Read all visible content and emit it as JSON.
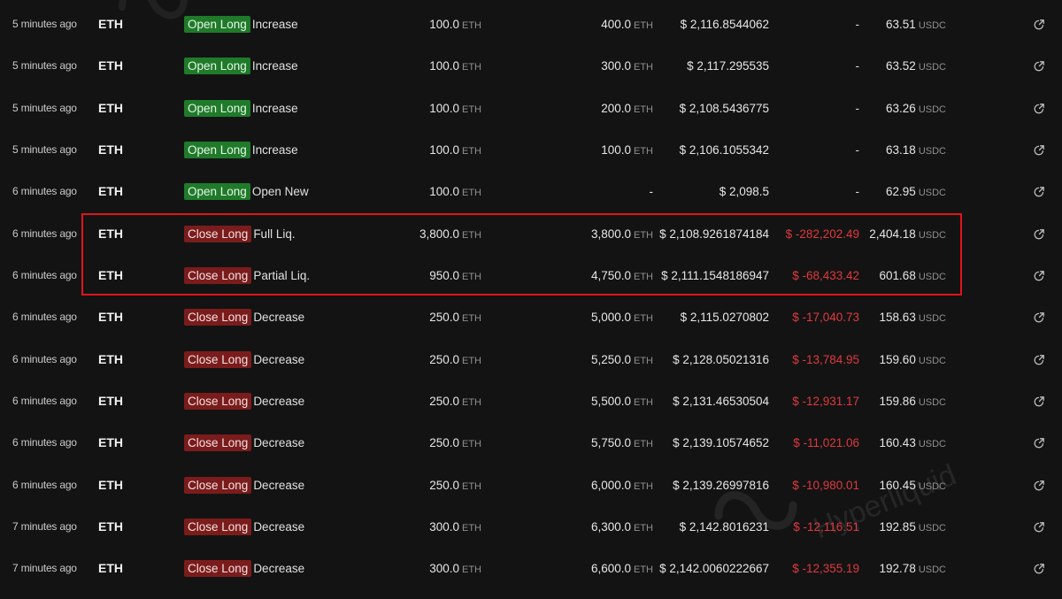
{
  "rows": [
    {
      "time": "5 minutes ago",
      "coin": "ETH",
      "direction": "Open Long",
      "kind": "open",
      "action": "Increase",
      "size": "100.0",
      "size_unit": "ETH",
      "position": "400.0",
      "position_unit": "ETH",
      "price": "$ 2,116.8544062",
      "pnl": "-",
      "pnl_neg": false,
      "fee": "63.51",
      "fee_unit": "USDC"
    },
    {
      "time": "5 minutes ago",
      "coin": "ETH",
      "direction": "Open Long",
      "kind": "open",
      "action": "Increase",
      "size": "100.0",
      "size_unit": "ETH",
      "position": "300.0",
      "position_unit": "ETH",
      "price": "$ 2,117.295535",
      "pnl": "-",
      "pnl_neg": false,
      "fee": "63.52",
      "fee_unit": "USDC"
    },
    {
      "time": "5 minutes ago",
      "coin": "ETH",
      "direction": "Open Long",
      "kind": "open",
      "action": "Increase",
      "size": "100.0",
      "size_unit": "ETH",
      "position": "200.0",
      "position_unit": "ETH",
      "price": "$ 2,108.5436775",
      "pnl": "-",
      "pnl_neg": false,
      "fee": "63.26",
      "fee_unit": "USDC"
    },
    {
      "time": "5 minutes ago",
      "coin": "ETH",
      "direction": "Open Long",
      "kind": "open",
      "action": "Increase",
      "size": "100.0",
      "size_unit": "ETH",
      "position": "100.0",
      "position_unit": "ETH",
      "price": "$ 2,106.1055342",
      "pnl": "-",
      "pnl_neg": false,
      "fee": "63.18",
      "fee_unit": "USDC"
    },
    {
      "time": "6 minutes ago",
      "coin": "ETH",
      "direction": "Open Long",
      "kind": "open",
      "action": "Open New",
      "size": "100.0",
      "size_unit": "ETH",
      "position": "-",
      "position_unit": "",
      "price": "$ 2,098.5",
      "pnl": "-",
      "pnl_neg": false,
      "fee": "62.95",
      "fee_unit": "USDC"
    },
    {
      "time": "6 minutes ago",
      "coin": "ETH",
      "direction": "Close Long",
      "kind": "close",
      "action": "Full Liq.",
      "size": "3,800.0",
      "size_unit": "ETH",
      "position": "3,800.0",
      "position_unit": "ETH",
      "price": "$ 2,108.9261874184",
      "pnl": "$ -282,202.49",
      "pnl_neg": true,
      "fee": "2,404.18",
      "fee_unit": "USDC"
    },
    {
      "time": "6 minutes ago",
      "coin": "ETH",
      "direction": "Close Long",
      "kind": "close",
      "action": "Partial Liq.",
      "size": "950.0",
      "size_unit": "ETH",
      "position": "4,750.0",
      "position_unit": "ETH",
      "price": "$ 2,111.1548186947",
      "pnl": "$ -68,433.42",
      "pnl_neg": true,
      "fee": "601.68",
      "fee_unit": "USDC"
    },
    {
      "time": "6 minutes ago",
      "coin": "ETH",
      "direction": "Close Long",
      "kind": "close",
      "action": "Decrease",
      "size": "250.0",
      "size_unit": "ETH",
      "position": "5,000.0",
      "position_unit": "ETH",
      "price": "$ 2,115.0270802",
      "pnl": "$ -17,040.73",
      "pnl_neg": true,
      "fee": "158.63",
      "fee_unit": "USDC"
    },
    {
      "time": "6 minutes ago",
      "coin": "ETH",
      "direction": "Close Long",
      "kind": "close",
      "action": "Decrease",
      "size": "250.0",
      "size_unit": "ETH",
      "position": "5,250.0",
      "position_unit": "ETH",
      "price": "$ 2,128.05021316",
      "pnl": "$ -13,784.95",
      "pnl_neg": true,
      "fee": "159.60",
      "fee_unit": "USDC"
    },
    {
      "time": "6 minutes ago",
      "coin": "ETH",
      "direction": "Close Long",
      "kind": "close",
      "action": "Decrease",
      "size": "250.0",
      "size_unit": "ETH",
      "position": "5,500.0",
      "position_unit": "ETH",
      "price": "$ 2,131.46530504",
      "pnl": "$ -12,931.17",
      "pnl_neg": true,
      "fee": "159.86",
      "fee_unit": "USDC"
    },
    {
      "time": "6 minutes ago",
      "coin": "ETH",
      "direction": "Close Long",
      "kind": "close",
      "action": "Decrease",
      "size": "250.0",
      "size_unit": "ETH",
      "position": "5,750.0",
      "position_unit": "ETH",
      "price": "$ 2,139.10574652",
      "pnl": "$ -11,021.06",
      "pnl_neg": true,
      "fee": "160.43",
      "fee_unit": "USDC"
    },
    {
      "time": "6 minutes ago",
      "coin": "ETH",
      "direction": "Close Long",
      "kind": "close",
      "action": "Decrease",
      "size": "250.0",
      "size_unit": "ETH",
      "position": "6,000.0",
      "position_unit": "ETH",
      "price": "$ 2,139.26997816",
      "pnl": "$ -10,980.01",
      "pnl_neg": true,
      "fee": "160.45",
      "fee_unit": "USDC"
    },
    {
      "time": "7 minutes ago",
      "coin": "ETH",
      "direction": "Close Long",
      "kind": "close",
      "action": "Decrease",
      "size": "300.0",
      "size_unit": "ETH",
      "position": "6,300.0",
      "position_unit": "ETH",
      "price": "$ 2,142.8016231",
      "pnl": "$ -12,116.51",
      "pnl_neg": true,
      "fee": "192.85",
      "fee_unit": "USDC"
    },
    {
      "time": "7 minutes ago",
      "coin": "ETH",
      "direction": "Close Long",
      "kind": "close",
      "action": "Decrease",
      "size": "300.0",
      "size_unit": "ETH",
      "position": "6,600.0",
      "position_unit": "ETH",
      "price": "$ 2,142.0060222667",
      "pnl": "$ -12,355.19",
      "pnl_neg": true,
      "fee": "192.78",
      "fee_unit": "USDC"
    }
  ],
  "icons": {
    "row_link": "external-link-icon",
    "watermark": "hyperliquid-logo-icon"
  },
  "watermark_text": "Hyperliquid",
  "colors": {
    "open_badge": "#1f7a2a",
    "close_badge": "#7a1c1c",
    "negative_pnl": "#e0393e",
    "highlight_box": "#e0141b",
    "background": "#131313"
  }
}
